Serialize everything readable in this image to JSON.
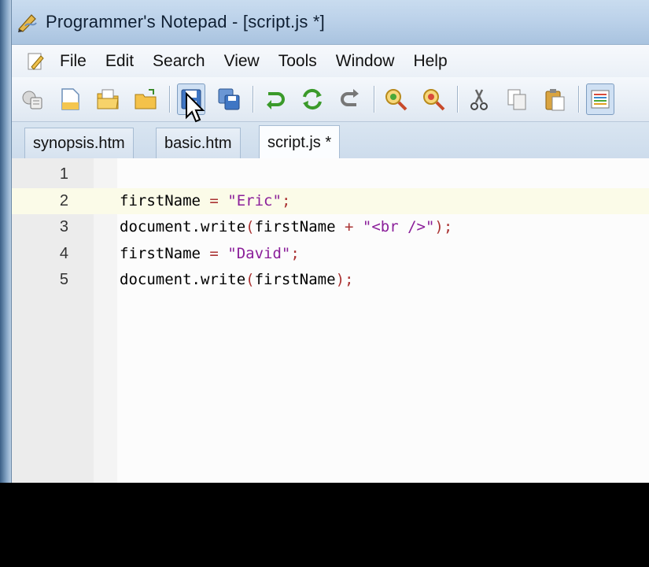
{
  "window": {
    "title": "Programmer's Notepad - [script.js *]"
  },
  "menu": {
    "items": [
      "File",
      "Edit",
      "Search",
      "View",
      "Tools",
      "Window",
      "Help"
    ]
  },
  "toolbar": {
    "buttons": [
      {
        "icon": "new-project-icon"
      },
      {
        "icon": "new-file-icon"
      },
      {
        "icon": "open-icon"
      },
      {
        "icon": "open-folder-icon"
      },
      {
        "icon": "save-icon",
        "state": "pressed"
      },
      {
        "icon": "save-all-icon"
      },
      {
        "icon": "undo-icon"
      },
      {
        "icon": "redo-icon"
      },
      {
        "icon": "repeat-icon"
      },
      {
        "icon": "find-icon"
      },
      {
        "icon": "find-next-icon"
      },
      {
        "icon": "cut-icon"
      },
      {
        "icon": "copy-icon"
      },
      {
        "icon": "paste-icon"
      },
      {
        "icon": "view-options-icon"
      }
    ]
  },
  "tabs": [
    {
      "label": "synopsis.htm",
      "active": false
    },
    {
      "label": "basic.htm",
      "active": false
    },
    {
      "label": "script.js *",
      "active": true
    }
  ],
  "editor": {
    "lines": [
      {
        "number": "1",
        "tokens": []
      },
      {
        "number": "2",
        "current": true,
        "tokens": [
          {
            "t": "firstName ",
            "c": "plain"
          },
          {
            "t": "=",
            "c": "op"
          },
          {
            "t": " ",
            "c": "plain"
          },
          {
            "t": "\"Eric\"",
            "c": "str"
          },
          {
            "t": ";",
            "c": "op"
          }
        ]
      },
      {
        "number": "3",
        "tokens": [
          {
            "t": "document.write",
            "c": "plain"
          },
          {
            "t": "(",
            "c": "op"
          },
          {
            "t": "firstName ",
            "c": "plain"
          },
          {
            "t": "+",
            "c": "op"
          },
          {
            "t": " ",
            "c": "plain"
          },
          {
            "t": "\"<br />\"",
            "c": "str"
          },
          {
            "t": ");",
            "c": "op"
          }
        ]
      },
      {
        "number": "4",
        "tokens": [
          {
            "t": "firstName ",
            "c": "plain"
          },
          {
            "t": "=",
            "c": "op"
          },
          {
            "t": " ",
            "c": "plain"
          },
          {
            "t": "\"David\"",
            "c": "str"
          },
          {
            "t": ";",
            "c": "op"
          }
        ]
      },
      {
        "number": "5",
        "tokens": [
          {
            "t": "document.write",
            "c": "plain"
          },
          {
            "t": "(",
            "c": "op"
          },
          {
            "t": "firstName",
            "c": "plain"
          },
          {
            "t": ");",
            "c": "op"
          }
        ]
      }
    ]
  },
  "colors": {
    "operator": "#aa3333",
    "string": "#8b1f9a",
    "current_line": "#fbfbe8"
  }
}
